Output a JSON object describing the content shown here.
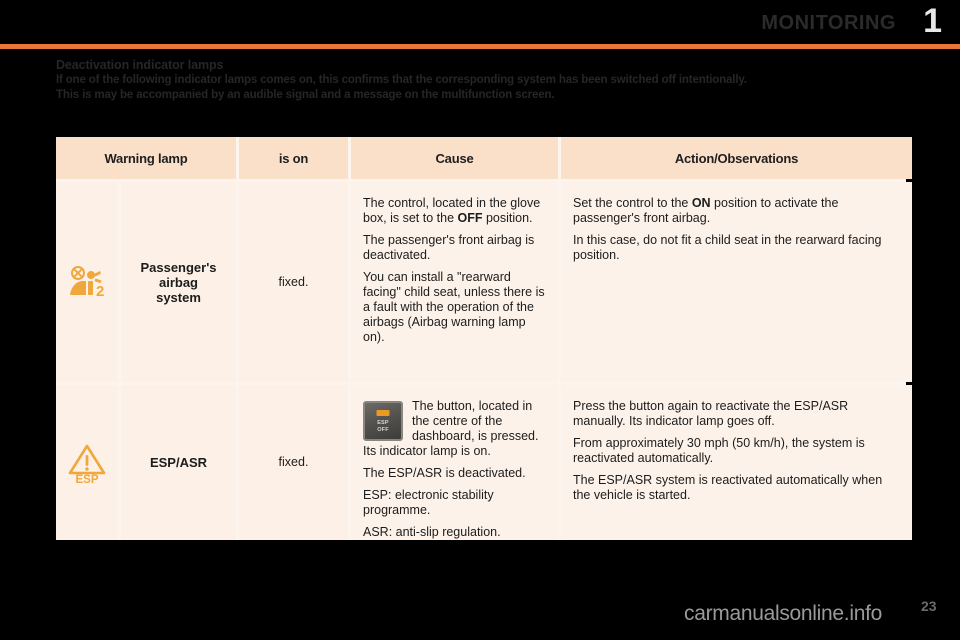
{
  "header": {
    "title": "MONITORING",
    "chapter": "1",
    "accent_color": "#e8763a"
  },
  "intro": {
    "heading": "Deactivation indicator lamps",
    "line1": "If one of the following indicator lamps comes on, this confirms that the corresponding system has been switched off intentionally.",
    "line2": "This is may be accompanied by an audible signal and a message on the multifunction screen."
  },
  "table": {
    "headers": {
      "lamp": "Warning lamp",
      "is_on": "is on",
      "cause": "Cause",
      "action": "Action/Observations"
    },
    "rows": [
      {
        "icon_name": "passenger-airbag-deactivated-icon",
        "lamp_label": "Passenger's\nairbag\nsystem",
        "lamp_label_lines": [
          "Passenger's",
          "airbag",
          "system"
        ],
        "is_on": "fixed.",
        "cause_paragraphs": [
          {
            "text_before": "The control, located in the glove box, is set to the ",
            "bold": "OFF",
            "text_after": " position."
          },
          {
            "text_before": "The passenger's front airbag is deactivated.",
            "bold": "",
            "text_after": ""
          },
          {
            "text_before": "You can install a \"rearward facing\" child seat, unless there is a fault with the operation of the airbags (Airbag warning lamp on).",
            "bold": "",
            "text_after": ""
          }
        ],
        "action_paragraphs": [
          {
            "text_before": "Set the control to the ",
            "bold": "ON",
            "text_after": " position to activate the passenger's front airbag."
          },
          {
            "text_before": "In this case, do not fit a child seat in the rearward facing position.",
            "bold": "",
            "text_after": ""
          }
        ]
      },
      {
        "icon_name": "esp-asr-warning-icon",
        "icon_text": "ESP",
        "lamp_label": "ESP/ASR",
        "is_on": "fixed.",
        "button_label_top": "ESP",
        "button_label_bottom": "OFF",
        "cause_paragraphs": [
          {
            "text_before": "The button, located in the centre of the dashboard, is pressed. Its indicator lamp is on.",
            "bold": "",
            "text_after": ""
          },
          {
            "text_before": "The ESP/ASR is deactivated.",
            "bold": "",
            "text_after": ""
          },
          {
            "text_before": "ESP: electronic stability programme.",
            "bold": "",
            "text_after": ""
          },
          {
            "text_before": "ASR: anti-slip regulation.",
            "bold": "",
            "text_after": ""
          }
        ],
        "action_paragraphs": [
          {
            "text_before": "Press the button again to reactivate the ESP/ASR manually. Its indicator lamp goes off.",
            "bold": "",
            "text_after": ""
          },
          {
            "text_before": "From approximately 30 mph (50 km/h), the system is reactivated automatically.",
            "bold": "",
            "text_after": ""
          },
          {
            "text_before": "The ESP/ASR system is reactivated automatically when the vehicle is started.",
            "bold": "",
            "text_after": ""
          }
        ]
      }
    ]
  },
  "footer": {
    "watermark": "carmanualsonline.info",
    "page_number": "23"
  }
}
